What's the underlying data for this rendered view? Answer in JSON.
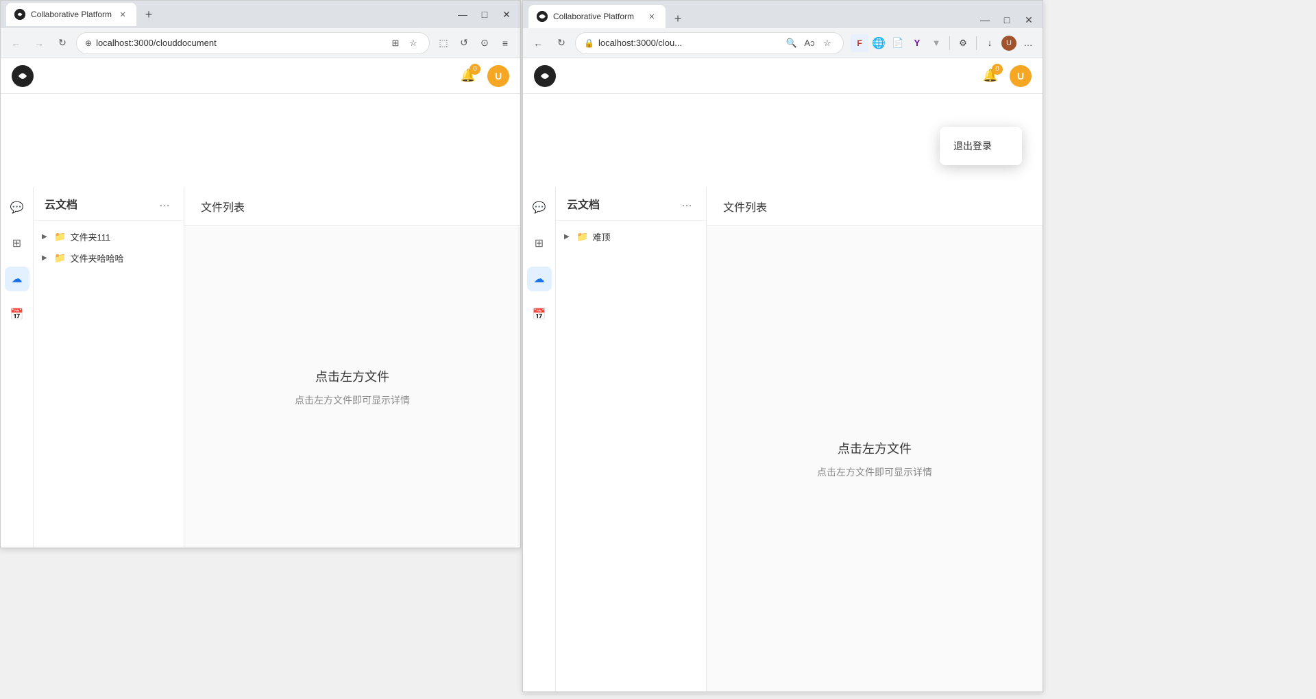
{
  "browser1": {
    "tab": {
      "title": "Collaborative Platform",
      "favicon": "●"
    },
    "tab_new_label": "+",
    "window_controls": {
      "minimize": "—",
      "maximize": "□",
      "close": "✕"
    },
    "address_bar": {
      "back_disabled": true,
      "forward_disabled": true,
      "refresh": "↻",
      "url": "localhost:3000/clouddocument",
      "lock_icon": "⊕",
      "extensions_icon": "⊞",
      "star_icon": "☆",
      "screenshot_icon": "⬚",
      "undo_icon": "↺",
      "plugin_icon": "⊙",
      "menu_icon": "≡"
    },
    "app": {
      "header": {
        "notification_count": "0",
        "user_label": "U"
      },
      "sidebar_icons": [
        {
          "name": "chat",
          "icon": "💬",
          "active": false
        },
        {
          "name": "grid",
          "icon": "⊞",
          "active": false
        },
        {
          "name": "cloud",
          "icon": "☁",
          "active": true
        },
        {
          "name": "calendar",
          "icon": "📅",
          "active": false
        }
      ],
      "file_tree": {
        "title": "云文档",
        "more_btn": "…",
        "items": [
          {
            "label": "文件夹111",
            "type": "folder"
          },
          {
            "label": "文件夹哈哈哈",
            "type": "folder"
          }
        ]
      },
      "content": {
        "header": "文件列表",
        "empty_title": "点击左方文件",
        "empty_subtitle": "点击左方文件即可显示详情"
      }
    }
  },
  "browser2": {
    "tab": {
      "title": "Collaborative Platform",
      "favicon": "●"
    },
    "tab_new_label": "+",
    "window_controls": {
      "minimize": "—",
      "maximize": "□",
      "close": "✕"
    },
    "address_bar": {
      "url": "localhost:3000/clou...",
      "lock_icon": "🔒"
    },
    "extra_toolbar_icons": [
      "F",
      "🌐",
      "📄",
      "Y",
      "▼",
      "↻",
      "|",
      "↓",
      "…"
    ],
    "app": {
      "header": {
        "notification_count": "0",
        "user_label": "U"
      },
      "sidebar_icons": [
        {
          "name": "chat",
          "icon": "💬",
          "active": false
        },
        {
          "name": "grid",
          "icon": "⊞",
          "active": false
        },
        {
          "name": "cloud",
          "icon": "☁",
          "active": true
        },
        {
          "name": "calendar",
          "icon": "📅",
          "active": false
        }
      ],
      "file_tree": {
        "title": "云文档",
        "more_btn": "…",
        "items": [
          {
            "label": "难顶",
            "type": "folder"
          }
        ]
      },
      "content": {
        "header": "文件列表",
        "empty_title": "点击左方文件",
        "empty_subtitle": "点击左方文件即可显示详情"
      }
    },
    "dropdown": {
      "item": "退出登录"
    }
  }
}
